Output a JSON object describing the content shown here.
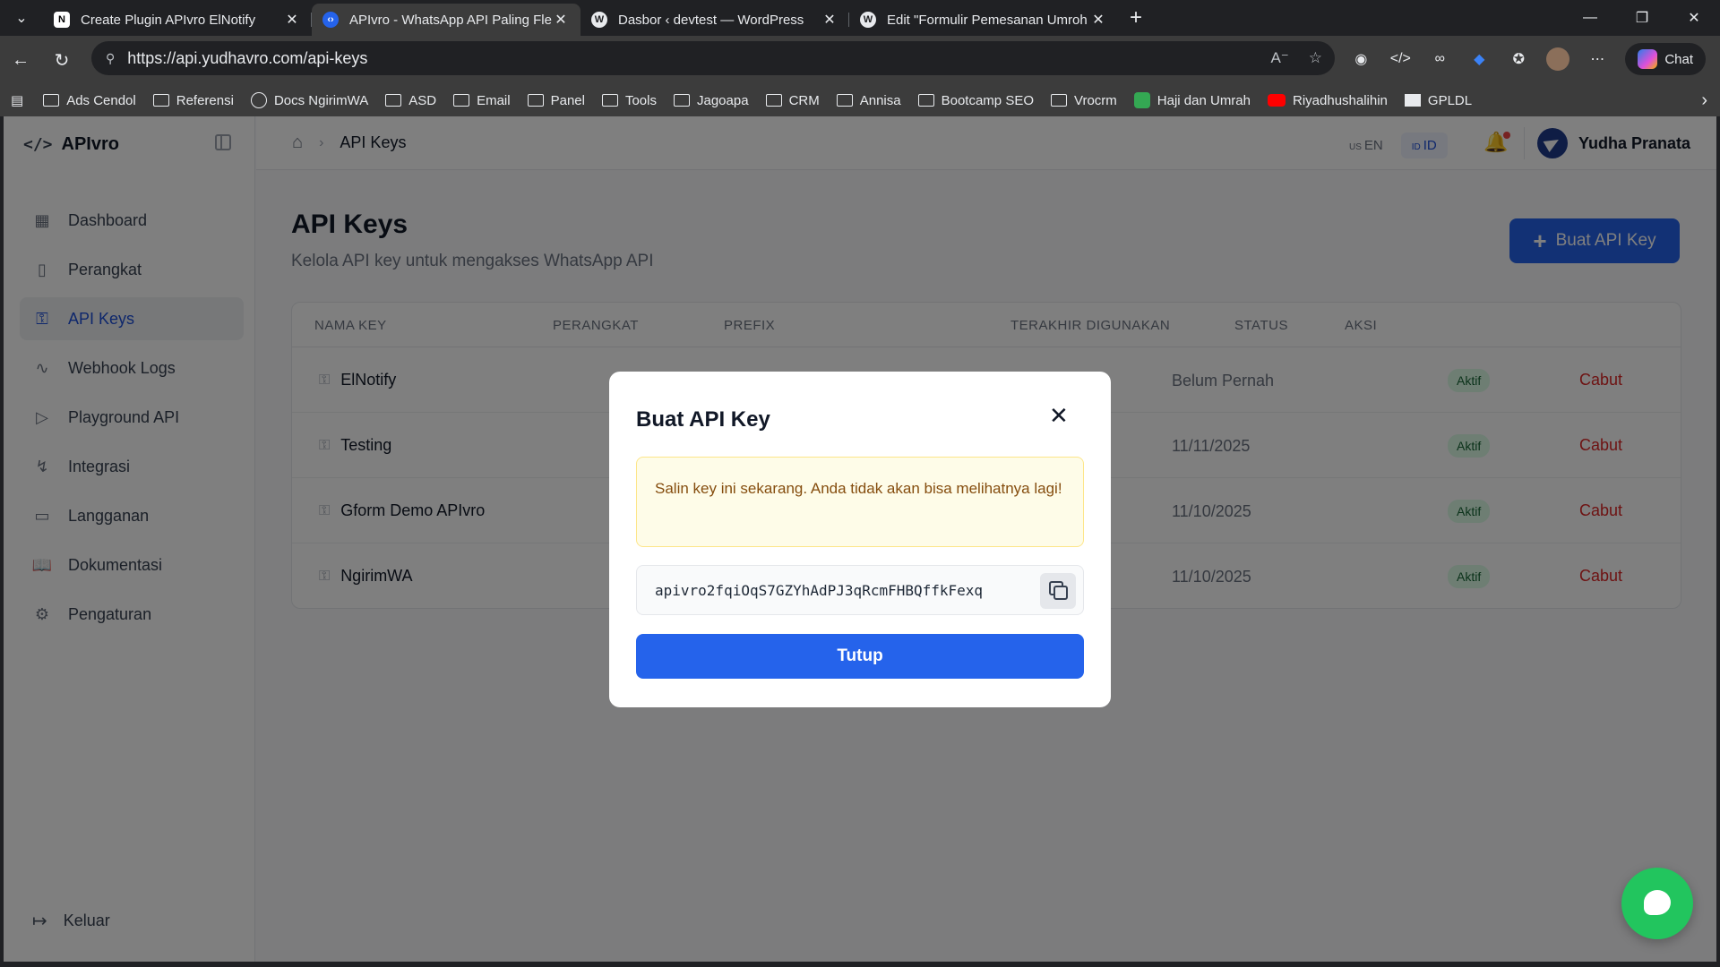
{
  "browser": {
    "tabs": [
      {
        "title": "Create Plugin APIvro ElNotify",
        "favicon": "notion-icon",
        "active": false
      },
      {
        "title": "APIvro - WhatsApp API Paling Fle",
        "favicon": "apivro-icon",
        "active": true
      },
      {
        "title": "Dasbor ‹ devtest — WordPress",
        "favicon": "wordpress-icon",
        "active": false
      },
      {
        "title": "Edit \"Formulir Pemesanan Umroh",
        "favicon": "wordpress-icon",
        "active": false
      }
    ],
    "url": "https://api.yudhavro.com/api-keys",
    "chat_label": "Chat",
    "bookmarks": [
      {
        "label": "Ads Cendol",
        "icon": "folder-icon"
      },
      {
        "label": "Referensi",
        "icon": "folder-icon"
      },
      {
        "label": "Docs NgirimWA",
        "icon": "globe-icon"
      },
      {
        "label": "ASD",
        "icon": "folder-icon"
      },
      {
        "label": "Email",
        "icon": "folder-icon"
      },
      {
        "label": "Panel",
        "icon": "folder-icon"
      },
      {
        "label": "Tools",
        "icon": "folder-icon"
      },
      {
        "label": "Jagoapa",
        "icon": "folder-icon"
      },
      {
        "label": "CRM",
        "icon": "folder-icon"
      },
      {
        "label": "Annisa",
        "icon": "folder-icon"
      },
      {
        "label": "Bootcamp SEO",
        "icon": "folder-icon"
      },
      {
        "label": "Vrocrm",
        "icon": "folder-icon"
      },
      {
        "label": "Haji dan Umrah",
        "icon": "hajj-icon"
      },
      {
        "label": "Riyadhushalihin",
        "icon": "youtube-icon"
      },
      {
        "label": "GPLDL",
        "icon": "gpldl-icon"
      }
    ]
  },
  "app": {
    "brand": "APIvro",
    "sidebar": {
      "items": [
        {
          "label": "Dashboard",
          "icon": "grid-icon"
        },
        {
          "label": "Perangkat",
          "icon": "phone-icon"
        },
        {
          "label": "API Keys",
          "icon": "key-icon",
          "active": true
        },
        {
          "label": "Webhook Logs",
          "icon": "activity-icon"
        },
        {
          "label": "Playground API",
          "icon": "play-icon"
        },
        {
          "label": "Integrasi",
          "icon": "bolt-icon"
        },
        {
          "label": "Langganan",
          "icon": "card-icon"
        },
        {
          "label": "Dokumentasi",
          "icon": "book-icon"
        },
        {
          "label": "Pengaturan",
          "icon": "gear-icon"
        }
      ],
      "logout": "Keluar"
    },
    "header": {
      "breadcrumb": "API Keys",
      "lang_en_flag": "US",
      "lang_en": "EN",
      "lang_id_flag": "ID",
      "lang_id": "ID",
      "user_name": "Yudha Pranata"
    },
    "main": {
      "title": "API Keys",
      "subtitle": "Kelola API key untuk mengakses WhatsApp API",
      "create_button": "Buat API Key",
      "table": {
        "headers": [
          "NAMA KEY",
          "PERANGKAT",
          "PREFIX",
          "TERAKHIR DIGUNAKAN",
          "STATUS",
          "AKSI"
        ],
        "rows": [
          {
            "name": "ElNotify",
            "last_used": "Belum Pernah",
            "status": "Aktif",
            "action": "Cabut"
          },
          {
            "name": "Testing",
            "last_used": "11/11/2025",
            "status": "Aktif",
            "action": "Cabut"
          },
          {
            "name": "Gform Demo APIvro",
            "last_used": "11/10/2025",
            "status": "Aktif",
            "action": "Cabut"
          },
          {
            "name": "NgirimWA",
            "last_used": "11/10/2025",
            "status": "Aktif",
            "action": "Cabut"
          }
        ]
      }
    },
    "modal": {
      "title": "Buat API Key",
      "warning": "Salin key ini sekarang. Anda tidak akan bisa melihatnya lagi!",
      "api_key": "apivro2fqiOqS7GZYhAdPJ3qRcmFHBQffkFexq",
      "close_button": "Tutup"
    },
    "colors": {
      "primary": "#2563eb",
      "danger": "#dc2626",
      "success_bg": "#dcfce7",
      "chat_fab": "#22c55e"
    }
  }
}
